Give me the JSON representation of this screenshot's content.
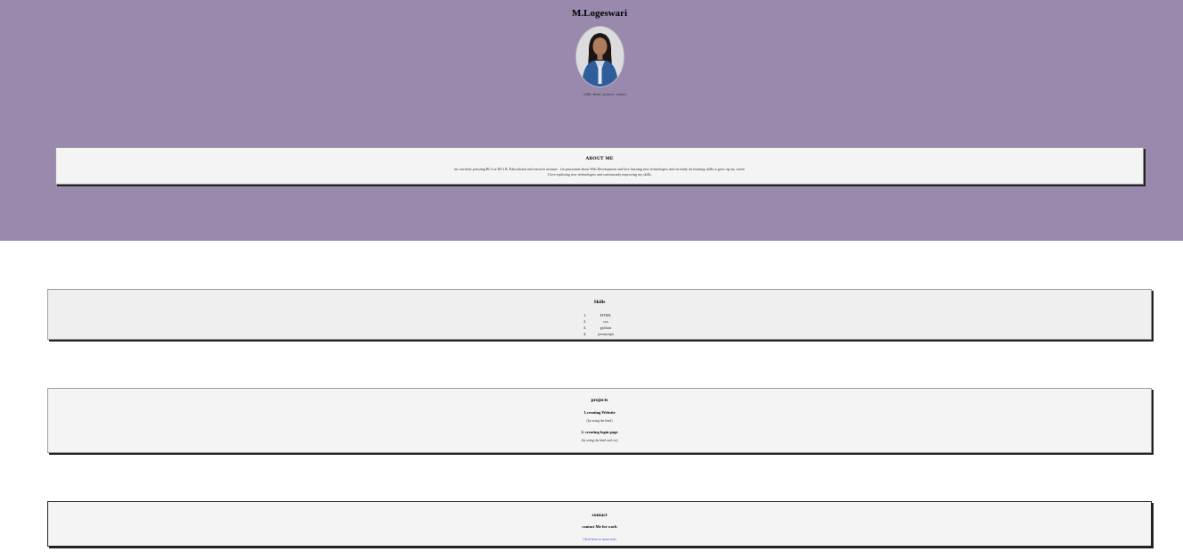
{
  "header": {
    "name": "M.Logeswari",
    "avatar_icon": "profile-photo-avatar",
    "nav": [
      "skills",
      "about",
      "projects",
      "contact"
    ]
  },
  "about": {
    "title": "ABOUT ME",
    "line1": "im currently pursuing BCA at M.G.R. Educational and research institute . i'm passionate about Web Development and love learning new technologies and currently im learning skills to grow up my career",
    "line2": "I love exploring new technologies and continuously improving my skills."
  },
  "skills": {
    "title": "Skills",
    "items": [
      {
        "num": "1.",
        "label": "HTML"
      },
      {
        "num": "2.",
        "label": "css"
      },
      {
        "num": "3.",
        "label": "python"
      },
      {
        "num": "4.",
        "label": "javascript"
      }
    ]
  },
  "projects": {
    "title": "projects",
    "items": [
      {
        "title": "1.creating Website",
        "desc": "(by using the html)"
      },
      {
        "title": "2. creating login page",
        "desc": "(by using the html and css)"
      }
    ]
  },
  "contact": {
    "title": "contact",
    "subtitle": "contact Me for work",
    "link_text": "Click here to more info"
  },
  "colors": {
    "hero_bg": "#9889ad",
    "card_bg": "#f4f4f4",
    "link": "#3f4fd6"
  }
}
